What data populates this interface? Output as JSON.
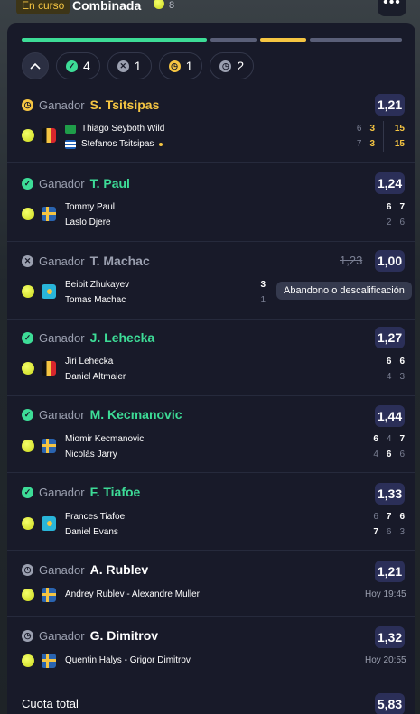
{
  "header": {
    "status": "En curso",
    "bet_type": "Combinada",
    "count": "8",
    "more_label": "•••"
  },
  "summary": {
    "won": "4",
    "lost": "1",
    "live": "1",
    "pending": "2"
  },
  "colors": {
    "won": "#3ddc97",
    "lost": "#9ba0b0",
    "live": "#f5c542",
    "pending": "#9ba0b0",
    "odds_bg": "#2b2f58"
  },
  "selections": [
    {
      "label": "Ganador",
      "pick": "S. Tsitsipas",
      "status": "live",
      "odds": "1,21",
      "p1": "Thiago Seyboth Wild",
      "p2": "Stefanos Tsitsipas",
      "s1": [
        "6",
        "3",
        "15"
      ],
      "s2": [
        "7",
        "3",
        "15"
      ]
    },
    {
      "label": "Ganador",
      "pick": "T. Paul",
      "status": "won",
      "odds": "1,24",
      "p1": "Tommy Paul",
      "p2": "Laslo Djere",
      "s1": [
        "6",
        "7"
      ],
      "s2": [
        "2",
        "6"
      ]
    },
    {
      "label": "Ganador",
      "pick": "T. Machac",
      "status": "lost",
      "odds": "1,00",
      "odds_old": "1,23",
      "p1": "Beibit Zhukayev",
      "p2": "Tomas Machac",
      "s1": [
        "3"
      ],
      "s2": [
        "1"
      ],
      "note": "Abandono o descalificación"
    },
    {
      "label": "Ganador",
      "pick": "J. Lehecka",
      "status": "won",
      "odds": "1,27",
      "p1": "Jiri Lehecka",
      "p2": "Daniel Altmaier",
      "s1": [
        "6",
        "6"
      ],
      "s2": [
        "4",
        "3"
      ]
    },
    {
      "label": "Ganador",
      "pick": "M. Kecmanovic",
      "status": "won",
      "odds": "1,44",
      "p1": "Miomir Kecmanovic",
      "p2": "Nicolás Jarry",
      "s1": [
        "6",
        "4",
        "7"
      ],
      "s2": [
        "4",
        "6",
        "6"
      ]
    },
    {
      "label": "Ganador",
      "pick": "F. Tiafoe",
      "status": "won",
      "odds": "1,33",
      "p1": "Frances Tiafoe",
      "p2": "Daniel Evans",
      "s1": [
        "6",
        "7",
        "6"
      ],
      "s2": [
        "7",
        "6",
        "3"
      ]
    },
    {
      "label": "Ganador",
      "pick": "A. Rublev",
      "status": "pending",
      "odds": "1,21",
      "match": "Andrey Rublev - Alexandre Muller",
      "time": "Hoy 19:45"
    },
    {
      "label": "Ganador",
      "pick": "G. Dimitrov",
      "status": "pending",
      "odds": "1,32",
      "match": "Quentin Halys - Grigor Dimitrov",
      "time": "Hoy 20:55"
    }
  ],
  "total": {
    "label": "Cuota total",
    "odds": "5,83"
  }
}
